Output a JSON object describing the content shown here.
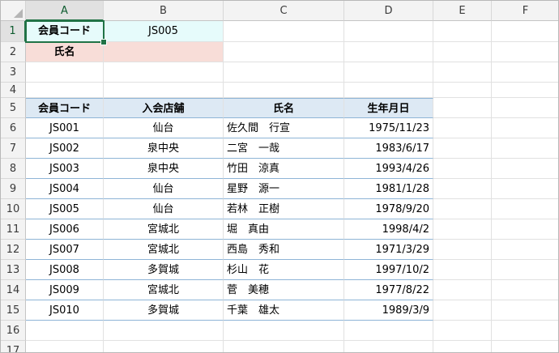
{
  "columns": [
    "A",
    "B",
    "C",
    "D",
    "E",
    "F"
  ],
  "rows": [
    "1",
    "2",
    "3",
    "4",
    "5",
    "6",
    "7",
    "8",
    "9",
    "10",
    "11",
    "12",
    "13",
    "14",
    "15",
    "16",
    "17"
  ],
  "selected_cell": "A1",
  "lookup": {
    "code_label": "会員コード",
    "code_value": "JS005",
    "name_label": "氏名",
    "name_value": ""
  },
  "table": {
    "headers": [
      "会員コード",
      "入会店舗",
      "氏名",
      "生年月日"
    ],
    "rows": [
      [
        "JS001",
        "仙台",
        "佐久間　行宣",
        "1975/11/23"
      ],
      [
        "JS002",
        "泉中央",
        "二宮　一哉",
        "1983/6/17"
      ],
      [
        "JS003",
        "泉中央",
        "竹田　涼真",
        "1993/4/26"
      ],
      [
        "JS004",
        "仙台",
        "星野　源一",
        "1981/1/28"
      ],
      [
        "JS005",
        "仙台",
        "若林　正樹",
        "1978/9/20"
      ],
      [
        "JS006",
        "宮城北",
        "堀　真由",
        "1998/4/2"
      ],
      [
        "JS007",
        "宮城北",
        "西島　秀和",
        "1971/3/29"
      ],
      [
        "JS008",
        "多賀城",
        "杉山　花",
        "1997/10/2"
      ],
      [
        "JS009",
        "宮城北",
        "菅　美穂",
        "1977/8/22"
      ],
      [
        "JS010",
        "多賀城",
        "千葉　雄太",
        "1989/3/9"
      ]
    ]
  },
  "colors": {
    "selection": "#217346",
    "lookup_code_fill": "#e6fbfb",
    "lookup_name_fill": "#f8ddd8",
    "table_header_fill": "#dde9f4",
    "table_border": "#8eb4d6"
  }
}
